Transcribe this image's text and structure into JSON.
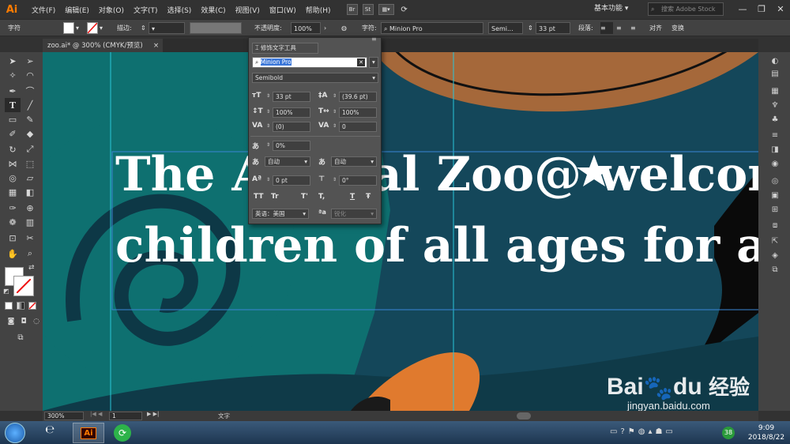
{
  "app": {
    "logo": "Ai",
    "accent": "#ff7c00"
  },
  "menu": [
    "文件(F)",
    "编辑(E)",
    "对象(O)",
    "文字(T)",
    "选择(S)",
    "效果(C)",
    "视图(V)",
    "窗口(W)",
    "帮助(H)"
  ],
  "menu_buttons": [
    "Br",
    "St"
  ],
  "workspace": "基本功能",
  "stock_search": {
    "placeholder": "搜索 Adobe Stock"
  },
  "window_controls": {
    "minimize": "—",
    "restore": "❐",
    "close": "✕"
  },
  "control": {
    "mode_label": "字符",
    "stroke_label": "描边:",
    "opacity_label": "不透明度:",
    "opacity_value": "100%",
    "char_label": "字符:",
    "font_family": "Minion Pro",
    "font_style": "Semi...",
    "font_size": "33 pt",
    "para_label": "段落:",
    "align_label": "对齐",
    "transform_label": "变换"
  },
  "document_tab": {
    "title": "zoo.ai* @ 300% (CMYK/预览)",
    "close": "×"
  },
  "char_panel": {
    "touch_tool": "修饰文字工具",
    "font_family": "Minion Pro",
    "font_style": "Semibold",
    "size": "33 pt",
    "leading": "(39.6 pt)",
    "vscale": "100%",
    "hscale": "100%",
    "kerning": "(0)",
    "tracking": "0",
    "tsume": "0%",
    "aki_left": "自动",
    "aki_right": "自动",
    "baseline": "0 pt",
    "rotation": "0°",
    "caps": [
      "TT",
      "Tr",
      "T'",
      "T,",
      "T",
      "Ŧ"
    ],
    "language": "英语：美国",
    "aa": "锐化"
  },
  "canvas": {
    "line1": "The Animal Zoo@ welcome",
    "line2": "children of all ages for an",
    "bg": "#14475a",
    "teal": "#0e7070",
    "brown": "#a5683a",
    "orange": "#e07a2e"
  },
  "status": {
    "zoom": "300%",
    "page": "1",
    "tool": "文字"
  },
  "watermark": {
    "brand": "Bai",
    "brand2": "du",
    "cn": "经验",
    "url": "jingyan.baidu.com"
  },
  "taskbar": {
    "time": "9:09",
    "date": "2018/8/22",
    "badge": "38"
  }
}
